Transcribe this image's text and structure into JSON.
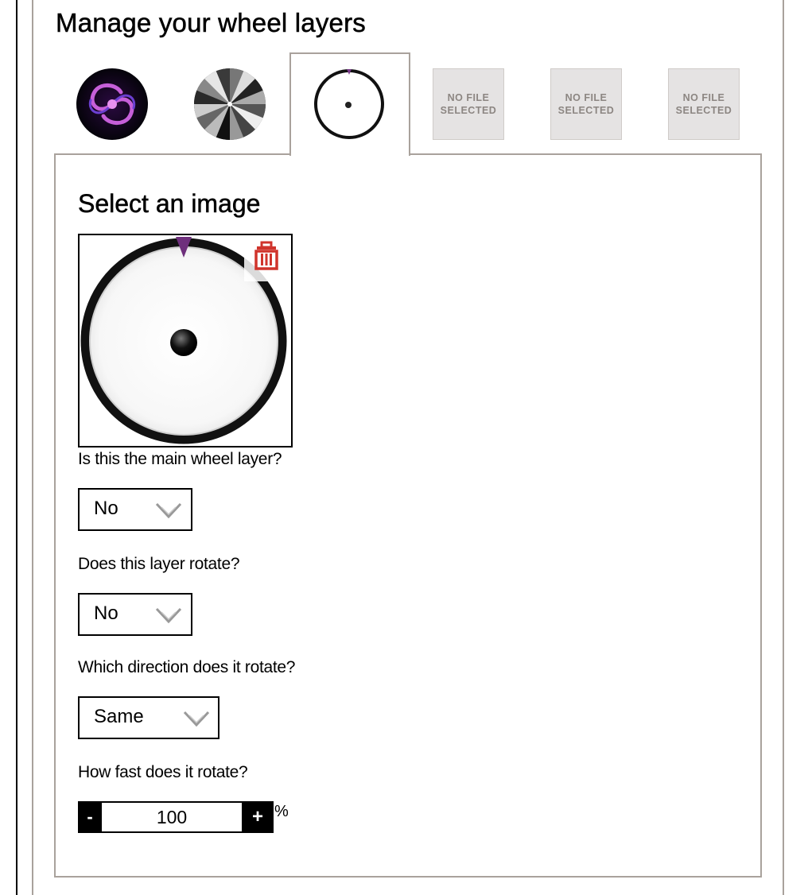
{
  "page": {
    "title": "Manage your wheel layers"
  },
  "tabs": [
    {
      "kind": "image",
      "icon": "purple-swirl-thumbnail"
    },
    {
      "kind": "image",
      "icon": "grey-segments-wheel-thumbnail"
    },
    {
      "kind": "image",
      "icon": "white-wheel-thumbnail",
      "active": true
    },
    {
      "kind": "empty",
      "line1": "NO FILE",
      "line2": "SELECTED"
    },
    {
      "kind": "empty",
      "line1": "NO FILE",
      "line2": "SELECTED"
    },
    {
      "kind": "empty",
      "line1": "NO FILE",
      "line2": "SELECTED"
    }
  ],
  "panel": {
    "title": "Select an image",
    "preview_icon": "white-wheel-preview",
    "delete_icon": "trash-icon",
    "delete_color": "#d0342c",
    "main_layer": {
      "label": "Is this the main wheel layer?",
      "value": "No"
    },
    "rotates": {
      "label": "Does this layer rotate?",
      "value": "No"
    },
    "direction": {
      "label": "Which direction does it rotate?",
      "value": "Same"
    },
    "speed": {
      "label": "How fast does it rotate?",
      "minus": "-",
      "value": "100",
      "plus": "+",
      "unit": "%"
    }
  }
}
